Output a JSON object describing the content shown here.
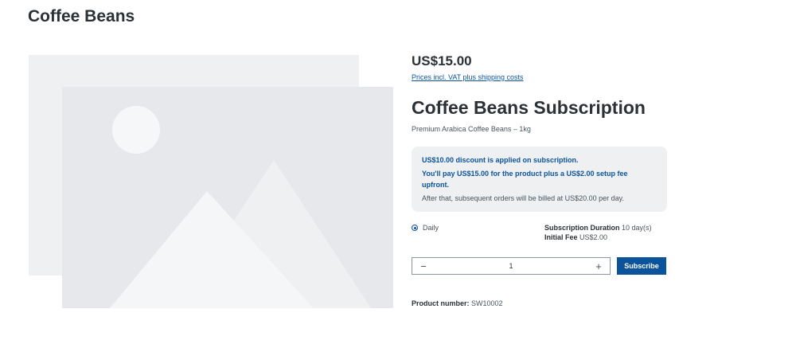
{
  "page": {
    "title": "Coffee Beans"
  },
  "gallery": {
    "image_placeholder_icon": "image-placeholder-icon"
  },
  "product": {
    "price": "US$15.00",
    "price_note": "Prices incl. VAT plus shipping costs",
    "name": "Coffee Beans Subscription",
    "subtitle": "Premium Arabica Coffee Beans – 1kg",
    "number_label": "Product number:",
    "number_value": "SW10002"
  },
  "subscription_info": {
    "discount": "US$10.00 discount is applied on subscription.",
    "pay_line_1": "You'll pay US$15.00 for the product plus a US$2.00 setup fee",
    "pay_line_2": "upfront.",
    "after": "After that, subsequent orders will be billed at US$20.00 per day."
  },
  "plan": {
    "option_label": "Daily",
    "selected": true,
    "duration_label": "Subscription Duration",
    "duration_value": "10 day(s)",
    "fee_label": "Initial Fee",
    "fee_value": "US$2.00"
  },
  "quantity": {
    "minus": "−",
    "value": "1",
    "plus": "+"
  },
  "actions": {
    "subscribe_label": "Subscribe"
  },
  "colors": {
    "accent": "#0b539b",
    "info_bg": "#eef0f2",
    "placeholder_back": "#eef0f2",
    "placeholder_front": "#e6e8ec"
  }
}
